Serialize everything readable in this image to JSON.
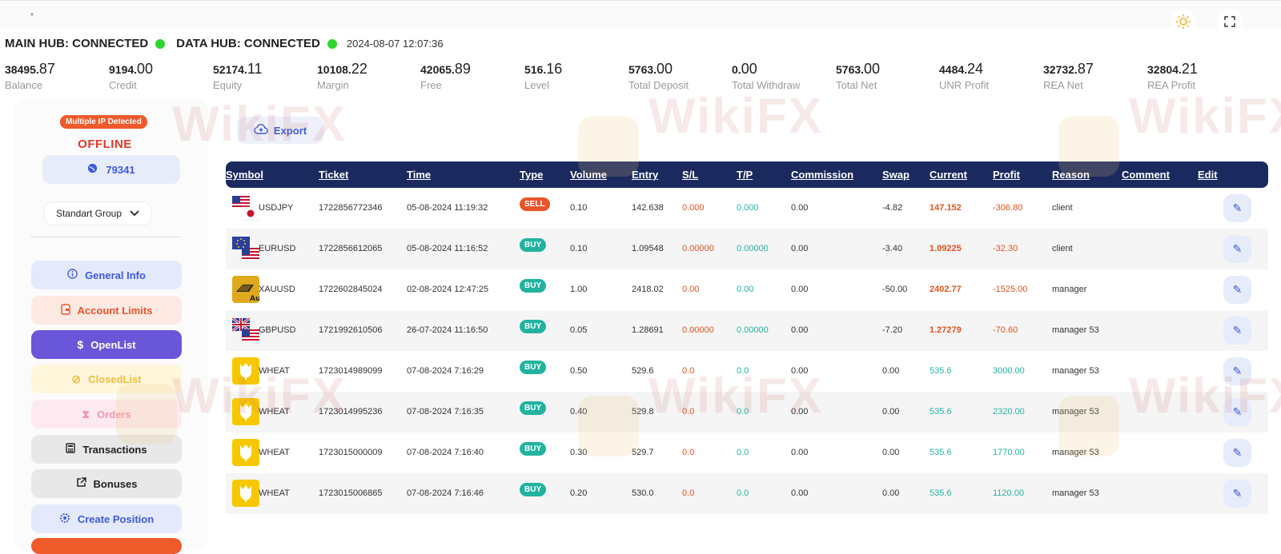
{
  "topbar": {
    "star": "*",
    "theme_icon": "sun-icon",
    "fullscreen_icon": "fullscreen-icon"
  },
  "hubs": {
    "main": "MAIN HUB: CONNECTED",
    "data": "DATA HUB: CONNECTED",
    "timestamp": "2024-08-07 12:07:36",
    "status_color": "#2ed52e"
  },
  "stats": [
    {
      "int": "38495.",
      "dec": "87",
      "label": "Balance"
    },
    {
      "int": "9194.",
      "dec": "00",
      "label": "Credit"
    },
    {
      "int": "52174.",
      "dec": "11",
      "label": "Equity"
    },
    {
      "int": "10108.",
      "dec": "22",
      "label": "Margin"
    },
    {
      "int": "42065.",
      "dec": "89",
      "label": "Free"
    },
    {
      "int": "516.",
      "dec": "16",
      "label": "Level"
    },
    {
      "int": "5763.",
      "dec": "00",
      "label": "Total Deposit"
    },
    {
      "int": "0.",
      "dec": "00",
      "label": "Total Withdraw"
    },
    {
      "int": "5763.",
      "dec": "00",
      "label": "Total Net"
    },
    {
      "int": "4484.",
      "dec": "24",
      "label": "UNR Profit"
    },
    {
      "int": "32732.",
      "dec": "87",
      "label": "REA Net"
    },
    {
      "int": "32804.",
      "dec": "21",
      "label": "REA Profit"
    }
  ],
  "sidebar": {
    "ip_badge": "Multiple IP Detected",
    "status": "OFFLINE",
    "account_id": "79341",
    "group": "Standart Group",
    "menu": {
      "general": "General Info",
      "limits": "Account Limits",
      "openlist": "OpenList",
      "closedlist": "ClosedList",
      "orders": "Orders",
      "transactions": "Transactions",
      "bonuses": "Bonuses",
      "create": "Create Position"
    }
  },
  "toolbar": {
    "export_label": "Export"
  },
  "table": {
    "headers": {
      "symbol": "Symbol",
      "ticket": "Ticket",
      "time": "Time",
      "type": "Type",
      "volume": "Volume",
      "entry": "Entry",
      "sl": "S/L",
      "tp": "T/P",
      "commission": "Commission",
      "swap": "Swap",
      "current": "Current",
      "profit": "Profit",
      "reason": "Reason",
      "comment": "Comment",
      "edit": "Edit"
    },
    "rows": [
      {
        "symbol": "USDJPY",
        "ticket": "1722856772346",
        "time": "05-08-2024 11:19:32",
        "type": "SELL",
        "volume": "0.10",
        "entry": "142.638",
        "sl": "0.000",
        "tp": "0.000",
        "commission": "0.00",
        "swap": "-4.82",
        "current": "147.152",
        "profit": "-306.80",
        "reason": "client",
        "comment": ""
      },
      {
        "symbol": "EURUSD",
        "ticket": "1722856612065",
        "time": "05-08-2024 11:16:52",
        "type": "BUY",
        "volume": "0.10",
        "entry": "1.09548",
        "sl": "0.00000",
        "tp": "0.00000",
        "commission": "0.00",
        "swap": "-3.40",
        "current": "1.09225",
        "profit": "-32.30",
        "reason": "client",
        "comment": ""
      },
      {
        "symbol": "XAUUSD",
        "ticket": "1722602845024",
        "time": "02-08-2024 12:47:25",
        "type": "BUY",
        "volume": "1.00",
        "entry": "2418.02",
        "sl": "0.00",
        "tp": "0.00",
        "commission": "0.00",
        "swap": "-50.00",
        "current": "2402.77",
        "profit": "-1525.00",
        "reason": "manager",
        "comment": ""
      },
      {
        "symbol": "GBPUSD",
        "ticket": "1721992610506",
        "time": "26-07-2024 11:16:50",
        "type": "BUY",
        "volume": "0.05",
        "entry": "1.28691",
        "sl": "0.00000",
        "tp": "0.00000",
        "commission": "0.00",
        "swap": "-7.20",
        "current": "1.27279",
        "profit": "-70.60",
        "reason": "manager 53",
        "comment": ""
      },
      {
        "symbol": "WHEAT",
        "ticket": "1723014989099",
        "time": "07-08-2024 7:16:29",
        "type": "BUY",
        "volume": "0.50",
        "entry": "529.6",
        "sl": "0.0",
        "tp": "0.0",
        "commission": "0.00",
        "swap": "0.00",
        "current": "535.6",
        "profit": "3000.00",
        "reason": "manager 53",
        "comment": ""
      },
      {
        "symbol": "WHEAT",
        "ticket": "1723014995236",
        "time": "07-08-2024 7:16:35",
        "type": "BUY",
        "volume": "0.40",
        "entry": "529.8",
        "sl": "0.0",
        "tp": "0.0",
        "commission": "0.00",
        "swap": "0.00",
        "current": "535.6",
        "profit": "2320.00",
        "reason": "manager 53",
        "comment": ""
      },
      {
        "symbol": "WHEAT",
        "ticket": "1723015000009",
        "time": "07-08-2024 7:16:40",
        "type": "BUY",
        "volume": "0.30",
        "entry": "529.7",
        "sl": "0.0",
        "tp": "0.0",
        "commission": "0.00",
        "swap": "0.00",
        "current": "535.6",
        "profit": "1770.00",
        "reason": "manager 53",
        "comment": ""
      },
      {
        "symbol": "WHEAT",
        "ticket": "1723015006865",
        "time": "07-08-2024 7:16:46",
        "type": "BUY",
        "volume": "0.20",
        "entry": "530.0",
        "sl": "0.0",
        "tp": "0.0",
        "commission": "0.00",
        "swap": "0.00",
        "current": "535.6",
        "profit": "1120.00",
        "reason": "manager 53",
        "comment": ""
      }
    ]
  },
  "watermark": "WikiFX",
  "colors": {
    "header_bg": "#1b2a5e",
    "accent": "#6a56d8",
    "negative": "#e2531d",
    "positive": "#21b5a0"
  }
}
